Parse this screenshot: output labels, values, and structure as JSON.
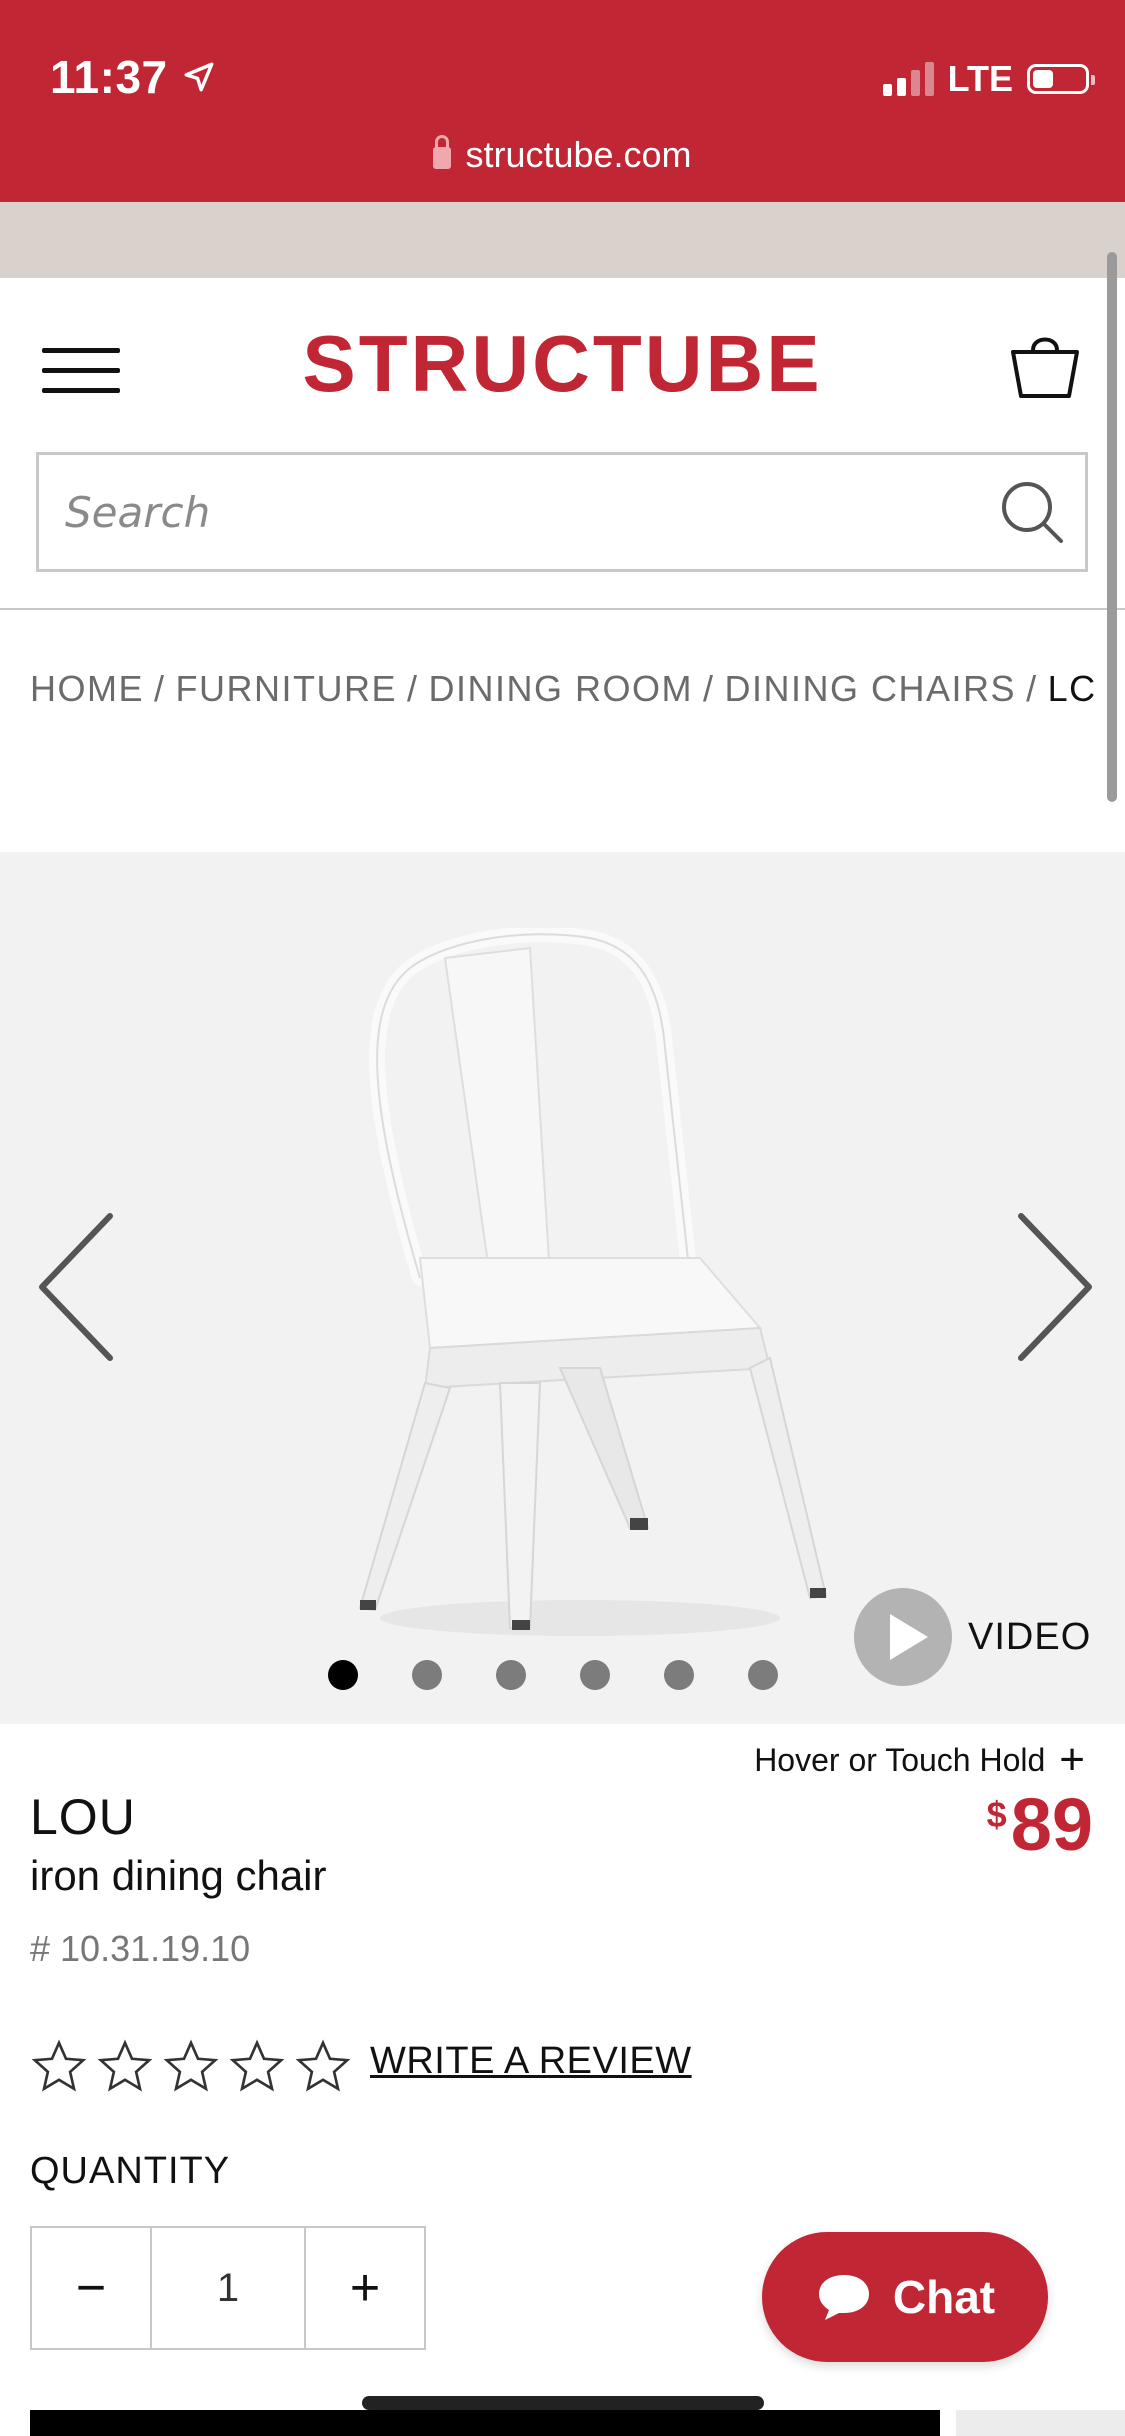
{
  "status_bar": {
    "time": "11:37",
    "network": "LTE",
    "url": "structube.com"
  },
  "header": {
    "logo": "STRUCTUBE",
    "search_placeholder": "Search"
  },
  "breadcrumb": {
    "items": [
      "HOME",
      "FURNITURE",
      "DINING ROOM",
      "DINING CHAIRS"
    ],
    "current": "LC",
    "separator": "/"
  },
  "gallery": {
    "image_count": 6,
    "active_index": 0,
    "video_label": "VIDEO"
  },
  "product": {
    "hover_hint": "Hover or Touch Hold",
    "hover_plus": "+",
    "name": "LOU",
    "description": "iron dining chair",
    "sku": "# 10.31.19.10",
    "price_currency": "$",
    "price_amount": "89",
    "rating": 0,
    "review_link": "WRITE A REVIEW"
  },
  "quantity": {
    "label": "QUANTITY",
    "minus": "−",
    "value": "1",
    "plus": "+"
  },
  "chat": {
    "label": "Chat"
  },
  "colors": {
    "brand_red": "#c02633",
    "banner_beige": "#d9d1cc",
    "gallery_bg": "#f2f2f2"
  }
}
